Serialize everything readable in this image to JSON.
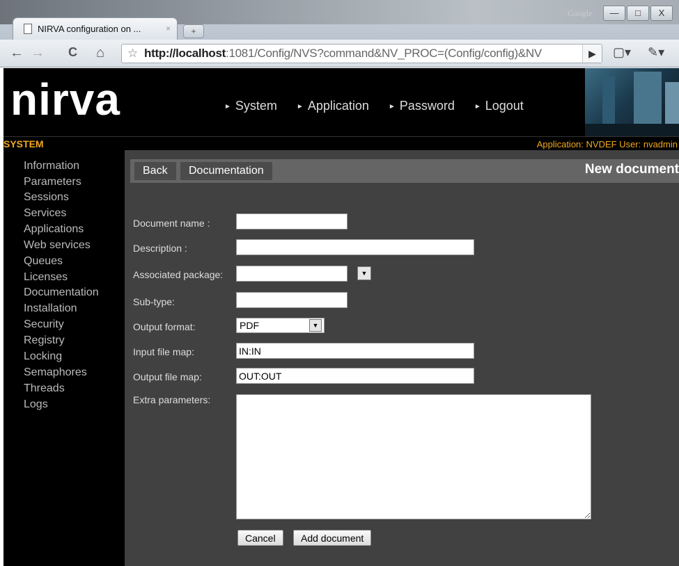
{
  "browser": {
    "tab_title": "NIRVA configuration on ...",
    "tab_close": "×",
    "new_tab_label": "+",
    "google_text": "Google",
    "window_controls": [
      "—",
      "□",
      "X"
    ],
    "url_host": "http://localhost",
    "url_rest": ":1081/Config/NVS?command&NV_PROC=(Config/config)&NV",
    "icons": [
      "back-icon",
      "forward-icon",
      "reload-icon",
      "home-icon",
      "bookmark-star-icon",
      "go-icon",
      "page-menu-icon",
      "wrench-icon"
    ]
  },
  "header": {
    "logo": "nirva",
    "nav": [
      {
        "label": "System"
      },
      {
        "label": "Application"
      },
      {
        "label": "Password"
      },
      {
        "label": "Logout"
      }
    ]
  },
  "sysbar": {
    "section": "SYSTEM",
    "application_info": "Application: NVDEF  User: nvadmin"
  },
  "sidebar": {
    "items": [
      "Information",
      "Parameters",
      "Sessions",
      "Services",
      "Applications",
      "Web services",
      "Queues",
      "Licenses",
      "Documentation",
      "Installation",
      "Security",
      "Registry",
      "Locking",
      "Semaphores",
      "Threads",
      "Logs"
    ]
  },
  "actionbar": {
    "back_label": "Back",
    "documentation_label": "Documentation",
    "heading": "New document"
  },
  "form": {
    "document_name_label": "Document name :",
    "document_name_value": "",
    "description_label": "Description :",
    "description_value": "",
    "associated_package_label": "Associated package:",
    "associated_package_value": "",
    "subtype_label": "Sub-type:",
    "subtype_value": "",
    "output_format_label": "Output format:",
    "output_format_value": "PDF",
    "input_file_map_label": "Input file map:",
    "input_file_map_value": "IN:IN",
    "output_file_map_label": "Output file map:",
    "output_file_map_value": "OUT:OUT",
    "extra_parameters_label": "Extra parameters:",
    "extra_parameters_value": "",
    "cancel_label": "Cancel",
    "add_label": "Add document"
  },
  "colors": {
    "accent": "#f0a81e",
    "content_bg": "#414141",
    "actionbar_bg": "#656565"
  }
}
